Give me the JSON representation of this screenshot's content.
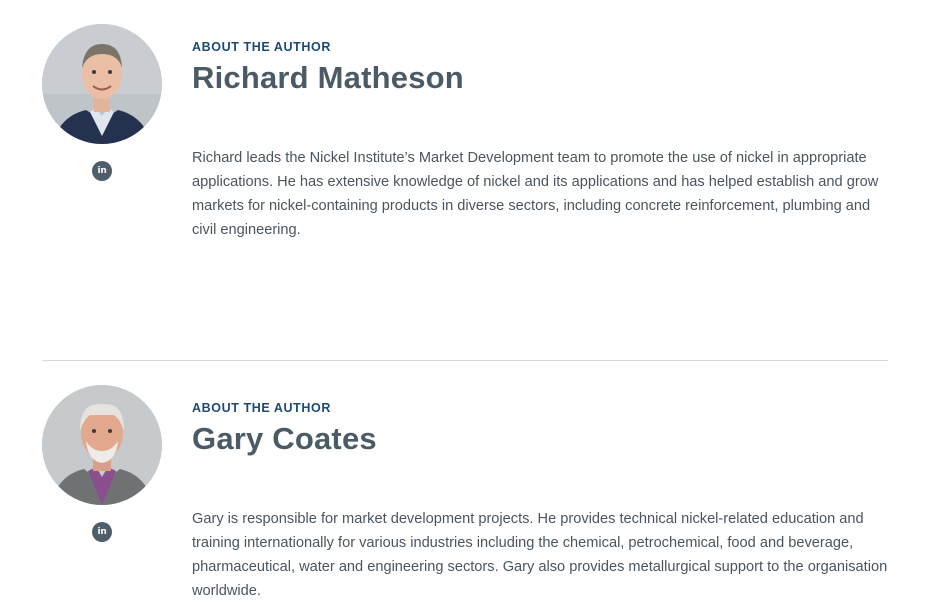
{
  "authors": [
    {
      "eyebrow": "ABOUT THE AUTHOR",
      "name": "Richard Matheson",
      "bio": "Richard leads the Nickel Institute’s Market Development team to promote the use of nickel in appropriate applications. He has extensive knowledge of nickel and its applications and has helped establish and grow markets for nickel-containing products in diverse sectors, including concrete reinforcement, plumbing and civil engineering.",
      "social_icon": "linkedin-icon",
      "social_glyph": "in"
    },
    {
      "eyebrow": "ABOUT THE AUTHOR",
      "name": "Gary Coates",
      "bio": "Gary is responsible for market development projects. He provides technical nickel-related education and training internationally for various industries including the chemical, petrochemical, food and beverage, pharmaceutical, water and engineering sectors. Gary also provides metallurgical support to the organisation worldwide.",
      "social_icon": "linkedin-icon",
      "social_glyph": "in"
    }
  ],
  "colors": {
    "eyebrow": "#1d4a7a",
    "name": "#4b5b66",
    "body": "#4a5560",
    "divider": "#d7dadd",
    "icon_bg": "#4e5e6a"
  }
}
